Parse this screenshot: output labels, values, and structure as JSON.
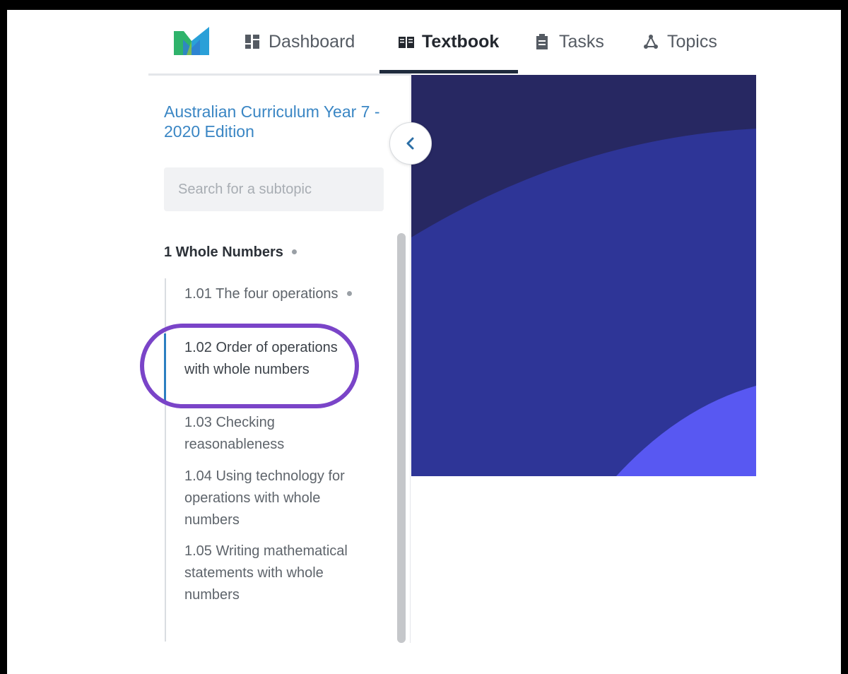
{
  "nav": {
    "items": [
      {
        "label": "Dashboard",
        "icon": "dashboard-icon"
      },
      {
        "label": "Textbook",
        "icon": "book-icon",
        "active": true
      },
      {
        "label": "Tasks",
        "icon": "clipboard-icon"
      },
      {
        "label": "Topics",
        "icon": "topics-network-icon"
      }
    ]
  },
  "sidebar": {
    "book_title": "Australian Curriculum Year 7 - 2020 Edition",
    "search_placeholder": "Search for a subtopic",
    "chapter": "1 Whole Numbers",
    "subtopics": [
      {
        "label": "1.01 The four operations",
        "status_dot": true
      },
      {
        "label": "1.02 Order of operations with whole numbers",
        "active": true,
        "highlighted": true
      },
      {
        "label": "1.03 Checking reasonableness"
      },
      {
        "label": "1.04 Using technology for operations with whole numbers"
      },
      {
        "label": "1.05 Writing mathematical statements with whole numbers"
      }
    ]
  },
  "colors": {
    "link_blue": "#3a86c4",
    "active_bar": "#2b7fc1",
    "highlight_purple": "#7a44c8",
    "hero_dark": "#272862",
    "hero_mid": "#2e3597",
    "hero_light": "#5858f2"
  }
}
